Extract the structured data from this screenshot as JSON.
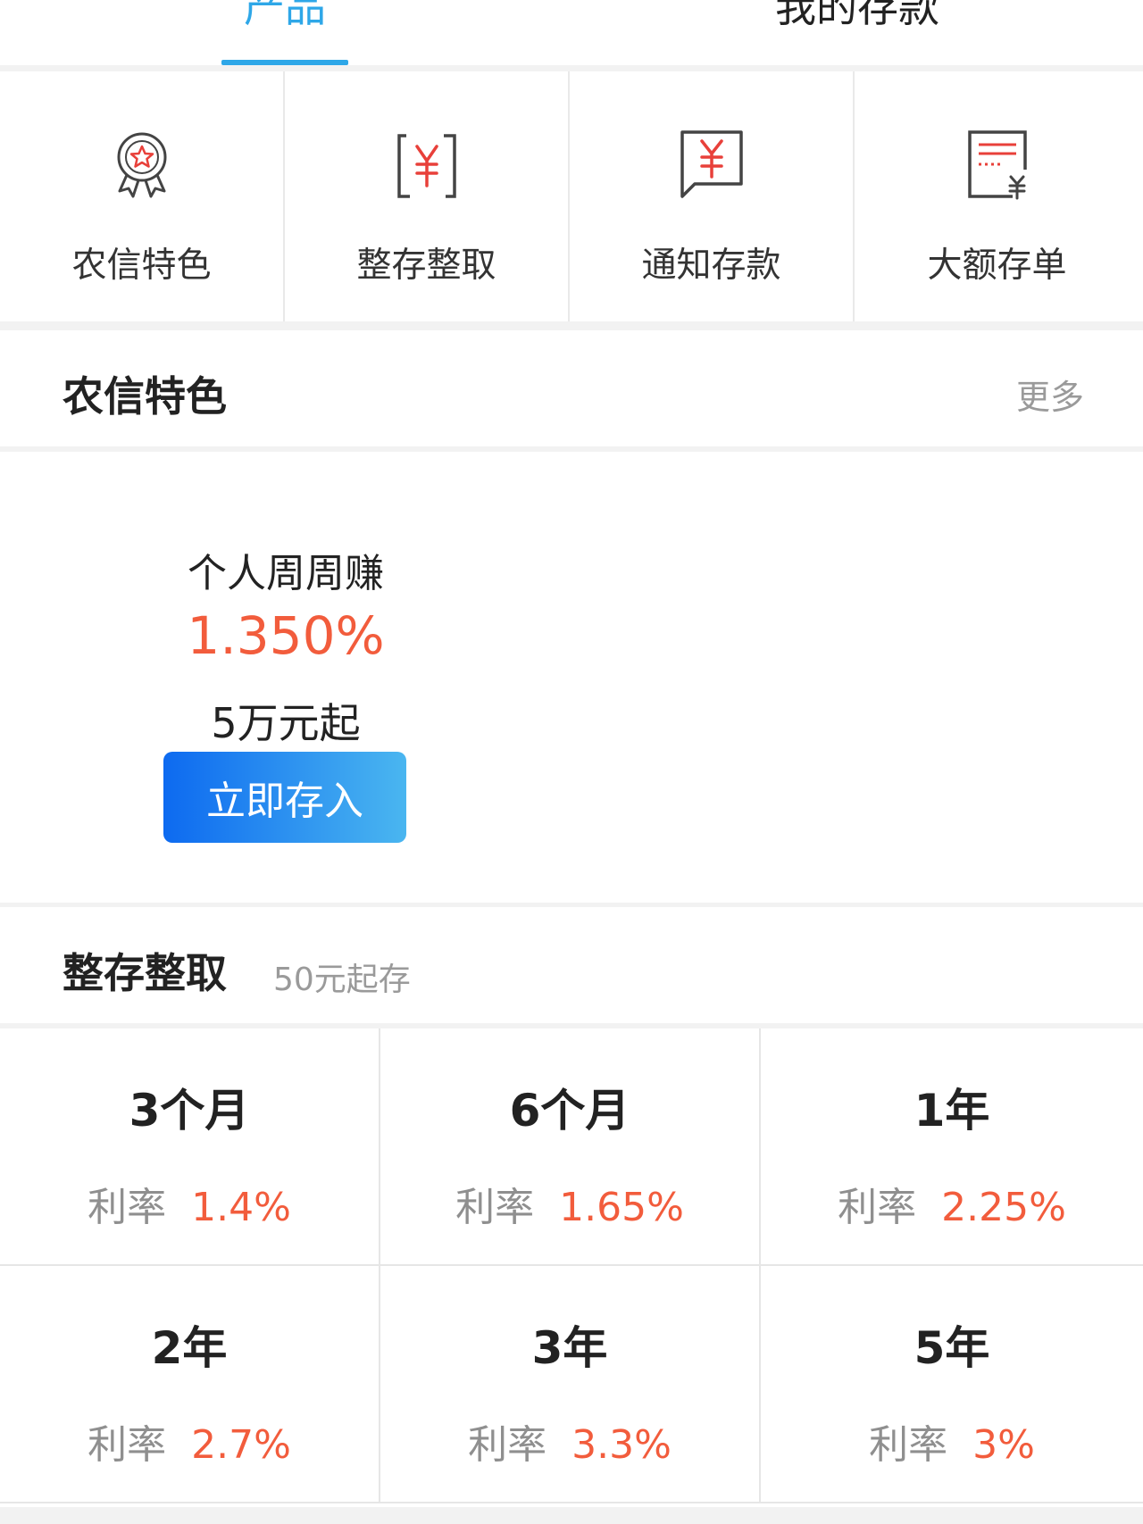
{
  "tabs": [
    {
      "label": "产品",
      "active": true
    },
    {
      "label": "我的存款",
      "active": false
    }
  ],
  "quick_actions": [
    {
      "label": "农信特色",
      "icon": "award-ribbon-icon"
    },
    {
      "label": "整存整取",
      "icon": "yuan-bracket-icon"
    },
    {
      "label": "通知存款",
      "icon": "yuan-message-icon"
    },
    {
      "label": "大额存单",
      "icon": "yuan-document-icon"
    }
  ],
  "featured_section": {
    "title": "农信特色",
    "more_label": "更多",
    "product": {
      "name": "个人周周赚",
      "rate": "1.350%",
      "min_amount": "5万元起",
      "button_label": "立即存入"
    }
  },
  "fixed_deposit": {
    "title": "整存整取",
    "subtitle": "50元起存",
    "rate_label": "利率",
    "items": [
      {
        "term": "3个月",
        "rate": "1.4%"
      },
      {
        "term": "6个月",
        "rate": "1.65%"
      },
      {
        "term": "1年",
        "rate": "2.25%"
      },
      {
        "term": "2年",
        "rate": "2.7%"
      },
      {
        "term": "3年",
        "rate": "3.3%"
      },
      {
        "term": "5年",
        "rate": "3%"
      }
    ]
  },
  "colors": {
    "accent": "#2ea7e8",
    "rate_red": "#f25c3c",
    "button_gradient_start": "#0d6af0",
    "button_gradient_end": "#4ab6f0"
  }
}
